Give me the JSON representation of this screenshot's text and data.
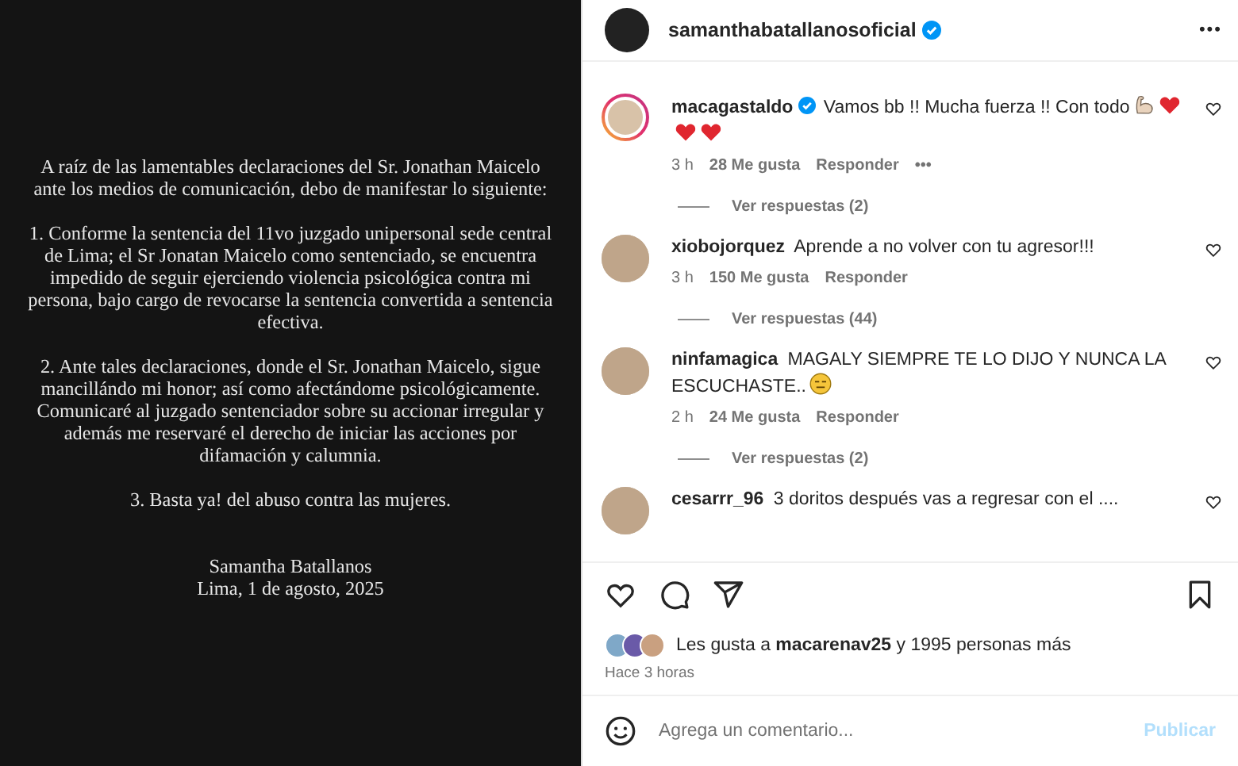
{
  "post_image": {
    "paragraphs": [
      "A raíz de las lamentables declaraciones del Sr. Jonathan Maicelo ante los medios de comunicación, debo de manifestar lo siguiente:",
      "1. Conforme la sentencia del 11vo juzgado unipersonal sede central de Lima; el Sr Jonatan Maicelo como sentenciado, se encuentra impedido de seguir ejerciendo violencia psicológica contra mi persona, bajo cargo de revocarse la sentencia convertida a sentencia efectiva.",
      "2. Ante tales declaraciones, donde el Sr. Jonathan Maicelo, sigue mancillándo mi honor; así como afectándome psicológicamente. Comunicaré al juzgado sentenciador sobre su accionar irregular y además me reservaré el derecho de iniciar las acciones por difamación y calumnia.",
      "3. Basta ya! del abuso contra las mujeres."
    ],
    "signature": [
      "Samantha Batallanos",
      "Lima, 1 de agosto, 2025"
    ]
  },
  "header": {
    "username": "samanthabatallanosoficial",
    "verified": true,
    "more": "•••"
  },
  "comments": [
    {
      "username": "macagastaldo",
      "verified": true,
      "story_ring": true,
      "text": "Vamos bb !! Mucha fuerza !! Con todo",
      "emojis": [
        {
          "kind": "muscle"
        },
        {
          "kind": "heart"
        },
        {
          "kind": "heart"
        },
        {
          "kind": "heart"
        }
      ],
      "time": "3 h",
      "likes": "28 Me gusta",
      "reply": "Responder",
      "more": "•••",
      "replies": "Ver respuestas (2)"
    },
    {
      "username": "xiobojorquez",
      "verified": false,
      "story_ring": false,
      "text": "Aprende a no volver con tu agresor!!!",
      "time": "3 h",
      "likes": "150 Me gusta",
      "reply": "Responder",
      "replies": "Ver respuestas (44)"
    },
    {
      "username": "ninfamagica",
      "verified": false,
      "story_ring": false,
      "text": "MAGALY SIEMPRE TE LO DIJO Y NUNCA LA ESCUCHASTE..",
      "emojis": [
        {
          "kind": "expressionless"
        }
      ],
      "time": "2 h",
      "likes": "24 Me gusta",
      "reply": "Responder",
      "replies": "Ver respuestas (2)"
    },
    {
      "username": "cesarrr_96",
      "verified": false,
      "story_ring": false,
      "text": "3 doritos después vas a regresar con el ...."
    }
  ],
  "likes": {
    "prefix": "Les gusta a ",
    "user": "macarenav25",
    "suffix": " y 1995 personas más"
  },
  "posted": "Hace 3 horas",
  "composer": {
    "placeholder": "Agrega un comentario...",
    "submit": "Publicar"
  }
}
